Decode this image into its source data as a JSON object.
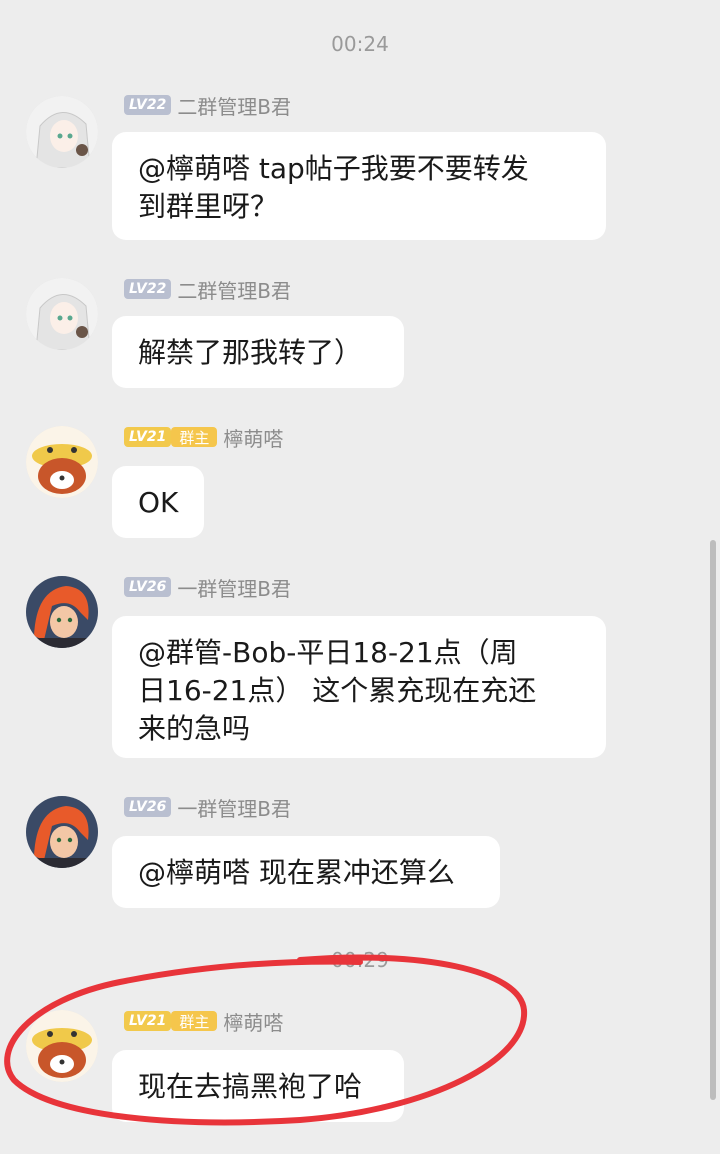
{
  "timestamps": [
    "00:24",
    "00:29"
  ],
  "messages": [
    {
      "level": "LV22",
      "role": "",
      "sender": "二群管理B君",
      "lines": [
        "@檸萌嗒 tap帖子我要不要转发",
        "到群里呀？"
      ]
    },
    {
      "level": "LV22",
      "role": "",
      "sender": "二群管理B君",
      "lines": [
        "解禁了那我转了）"
      ]
    },
    {
      "level": "LV21",
      "role": "群主",
      "sender": "檸萌嗒",
      "lines": [
        "OK"
      ]
    },
    {
      "level": "LV26",
      "role": "",
      "sender": "一群管理B君",
      "lines": [
        "@群管-Bob-平日18-21点（周",
        "日16-21点） 这个累充现在充还",
        "来的急吗"
      ]
    },
    {
      "level": "LV26",
      "role": "",
      "sender": "一群管理B君",
      "lines": [
        "@檸萌嗒 现在累冲还算么"
      ]
    },
    {
      "level": "LV21",
      "role": "群主",
      "sender": "檸萌嗒",
      "lines": [
        "现在去搞黑袍了哈"
      ]
    }
  ],
  "colors": {
    "background": "#ededed",
    "bubble": "#ffffff",
    "annotation": "#e8343a",
    "level_badge": "#b9bfd0",
    "owner_badge": "#f5c64c"
  }
}
